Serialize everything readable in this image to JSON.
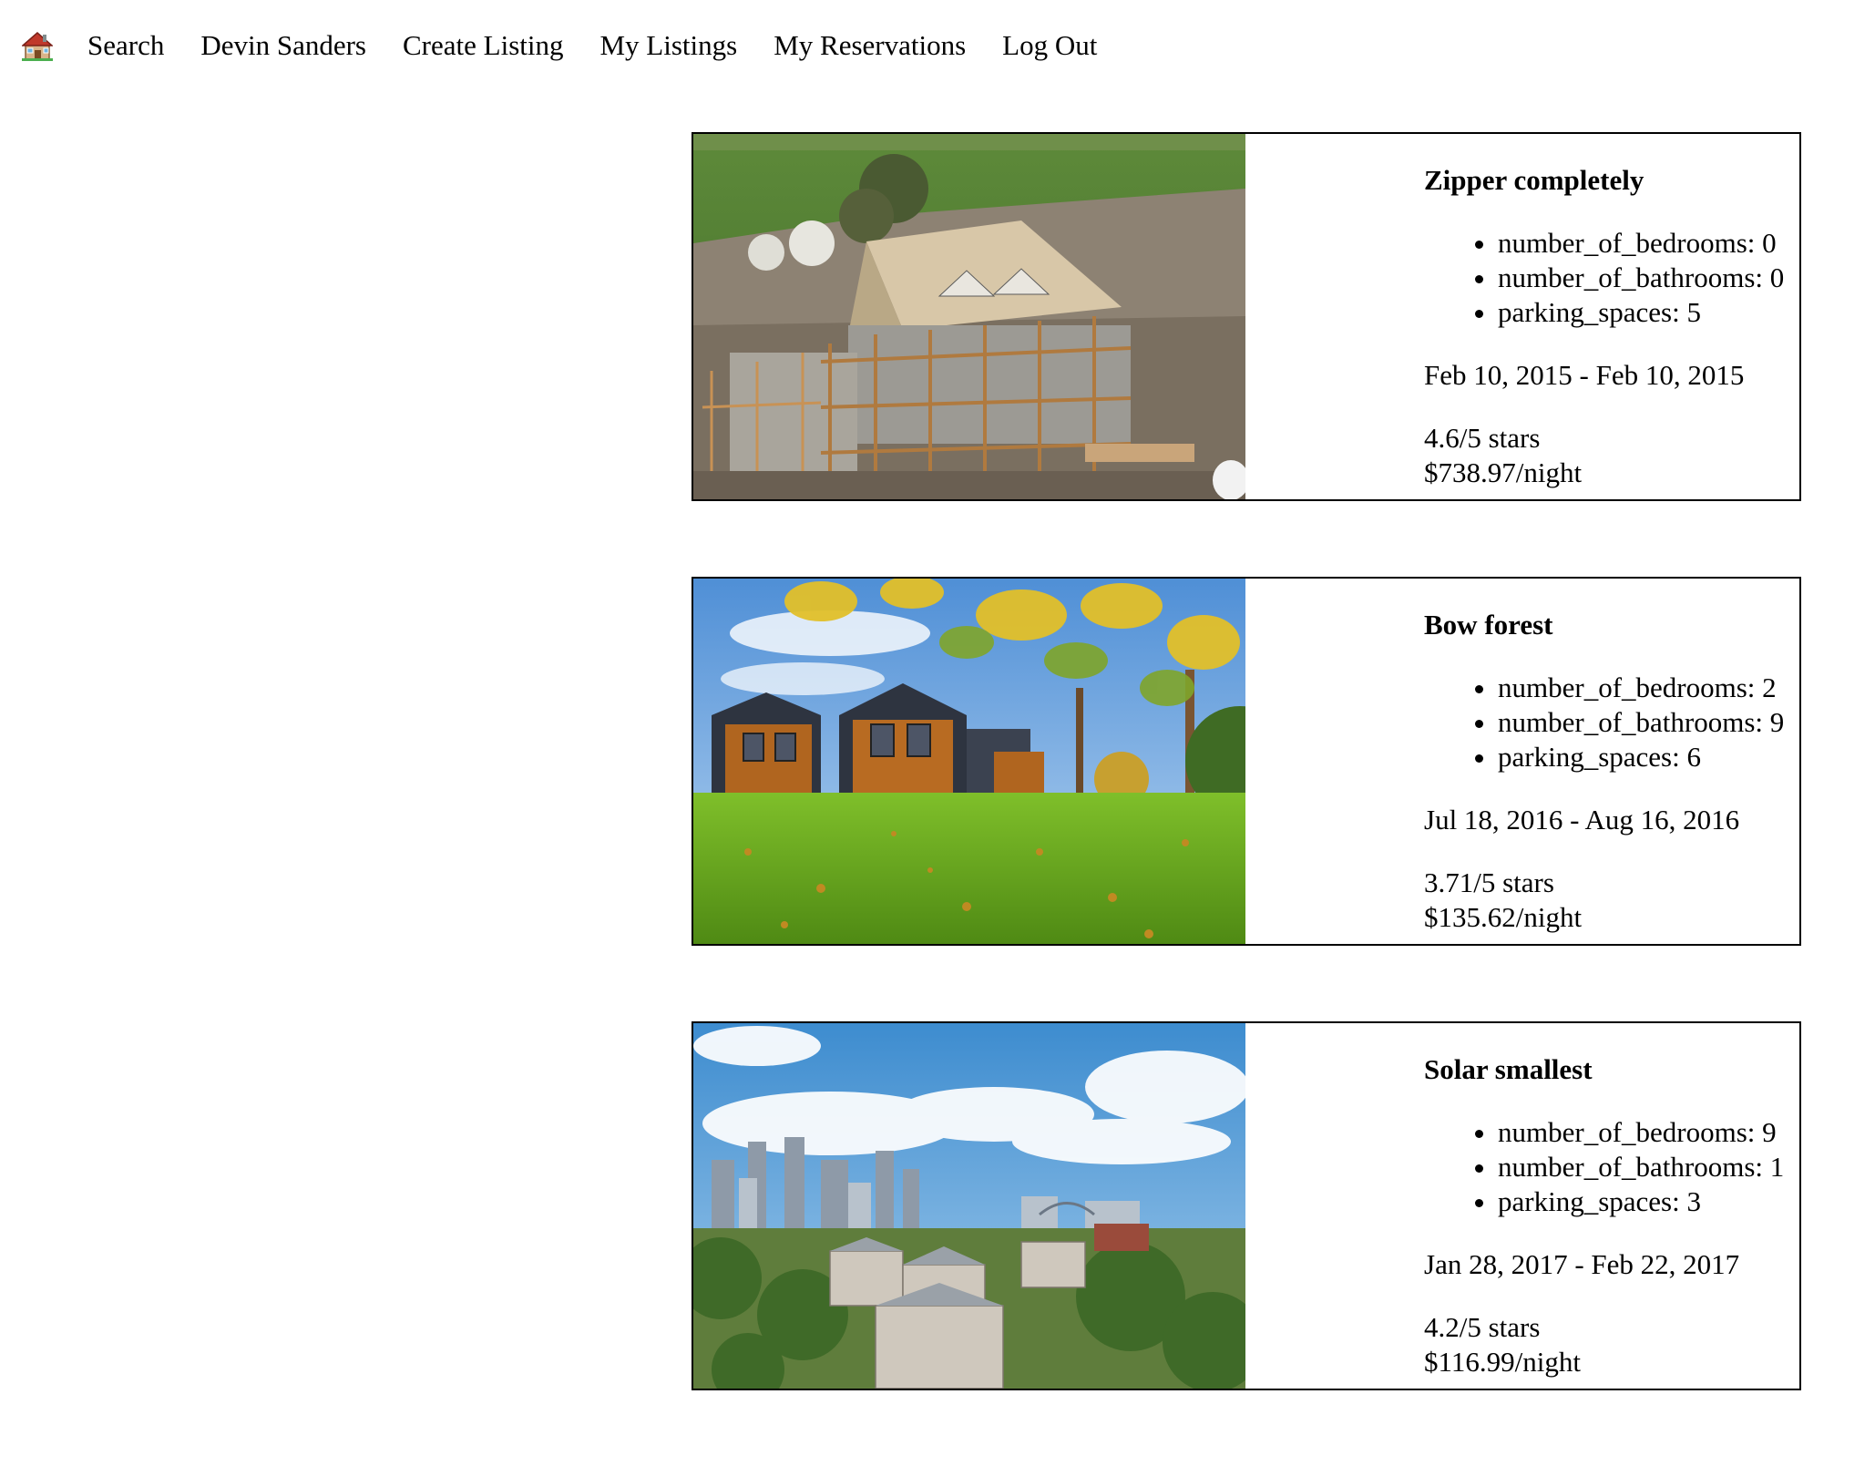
{
  "nav": {
    "home_icon": "house-emoji-icon",
    "items": [
      {
        "label": "Search"
      },
      {
        "label": "Devin Sanders"
      },
      {
        "label": "Create Listing"
      },
      {
        "label": "My Listings"
      },
      {
        "label": "My Reservations"
      },
      {
        "label": "Log Out"
      }
    ]
  },
  "listings": [
    {
      "title": "Zipper completely",
      "features": [
        "number_of_bedrooms: 0",
        "number_of_bathrooms: 0",
        "parking_spaces: 5"
      ],
      "dates": "Feb 10, 2015 - Feb 10, 2015",
      "rating": "4.6/5 stars",
      "price": "$738.97/night",
      "image": "house-under-construction-photo"
    },
    {
      "title": "Bow forest",
      "features": [
        "number_of_bedrooms: 2",
        "number_of_bathrooms: 9",
        "parking_spaces: 6"
      ],
      "dates": "Jul 18, 2016 - Aug 16, 2016",
      "rating": "3.71/5 stars",
      "price": "$135.62/night",
      "image": "modern-barn-houses-photo"
    },
    {
      "title": "Solar smallest",
      "features": [
        "number_of_bedrooms: 9",
        "number_of_bathrooms: 1",
        "parking_spaces: 3"
      ],
      "dates": "Jan 28, 2017 - Feb 22, 2017",
      "rating": "4.2/5 stars",
      "price": "$116.99/night",
      "image": "city-skyline-photo"
    }
  ]
}
